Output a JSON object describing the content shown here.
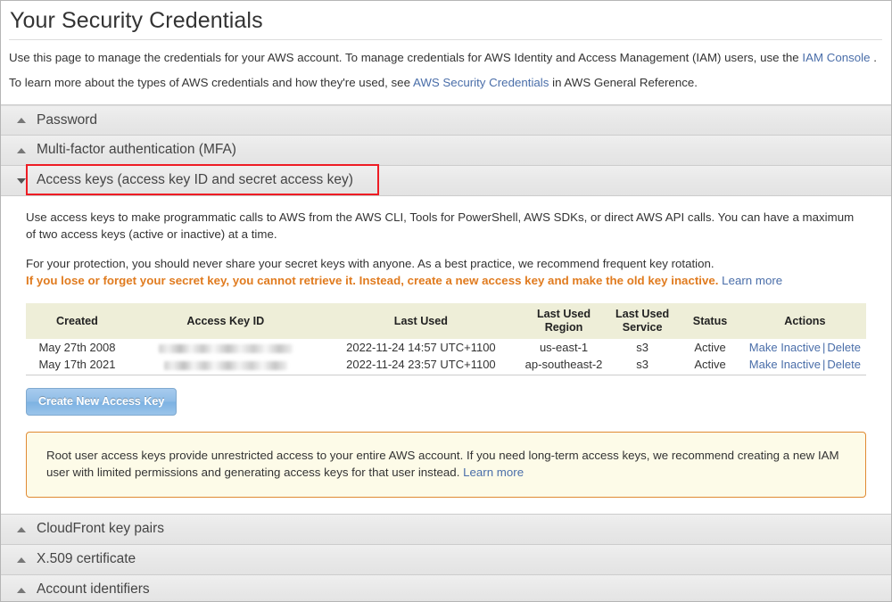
{
  "page": {
    "title": "Your Security Credentials",
    "intro_1_pre": "Use this page to manage the credentials for your AWS account. To manage credentials for AWS Identity and Access Management (IAM) users, use the ",
    "intro_1_link": "IAM Console",
    "intro_1_post": " .",
    "intro_2_pre": "To learn more about the types of AWS credentials and how they're used, see ",
    "intro_2_link": "AWS Security Credentials",
    "intro_2_post": " in AWS General Reference."
  },
  "sections": [
    {
      "label": "Password",
      "state": "collapsed",
      "icon": "triangle-up-icon"
    },
    {
      "label": "Multi-factor authentication (MFA)",
      "state": "collapsed",
      "icon": "triangle-up-icon"
    },
    {
      "label": "Access keys (access key ID and secret access key)",
      "state": "expanded",
      "icon": "triangle-down-icon"
    },
    {
      "label": "CloudFront key pairs",
      "state": "collapsed",
      "icon": "triangle-up-icon"
    },
    {
      "label": "X.509 certificate",
      "state": "collapsed",
      "icon": "triangle-up-icon"
    },
    {
      "label": "Account identifiers",
      "state": "collapsed",
      "icon": "triangle-up-icon"
    }
  ],
  "access_keys": {
    "para_1": "Use access keys to make programmatic calls to AWS from the AWS CLI, Tools for PowerShell, AWS SDKs, or direct AWS API calls. You can have a maximum of two access keys (active or inactive) at a time.",
    "para_2": "For your protection, you should never share your secret keys with anyone. As a best practice, we recommend frequent key rotation.",
    "warning": "If you lose or forget your secret key, you cannot retrieve it. Instead, create a new access key and make the old key inactive.",
    "warning_link": "Learn more",
    "columns": [
      "Created",
      "Access Key ID",
      "Last Used",
      "Last Used Region",
      "Last Used Service",
      "Status",
      "Actions"
    ],
    "rows": [
      {
        "created": "May 27th 2008",
        "access_key_id": "",
        "last_used": "2022-11-24 14:57 UTC+1100",
        "last_used_region": "us-east-1",
        "last_used_service": "s3",
        "status": "Active",
        "action_make_inactive": "Make Inactive",
        "action_separator": "|",
        "action_delete": "Delete"
      },
      {
        "created": "May 17th 2021",
        "access_key_id": "",
        "last_used": "2022-11-24 23:57 UTC+1100",
        "last_used_region": "ap-southeast-2",
        "last_used_service": "s3",
        "status": "Active",
        "action_make_inactive": "Make Inactive",
        "action_separator": "|",
        "action_delete": "Delete"
      }
    ],
    "create_button": "Create New Access Key",
    "callout_text": "Root user access keys provide unrestricted access to your entire AWS account. If you need long-term access keys, we recommend creating a new IAM user with limited permissions and generating access keys for that user instead.",
    "callout_link": "Learn more"
  },
  "colors": {
    "link": "#4a6ea9",
    "warning_orange": "#e07b1f",
    "table_header_bg": "#eeeed8",
    "callout_bg": "#fdfbe8",
    "callout_border": "#e08a32",
    "annotation_red": "#ee1c24",
    "button_blue": "#8fbce6"
  }
}
